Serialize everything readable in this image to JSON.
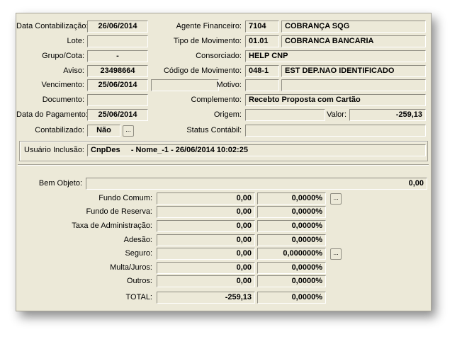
{
  "header": {
    "data_contabilizacao": {
      "label": "Data Contabilização:",
      "value": "26/06/2014"
    },
    "lote": {
      "label": "Lote:",
      "value": ""
    },
    "grupo_cota": {
      "label": "Grupo/Cota:",
      "value": "-"
    },
    "aviso": {
      "label": "Aviso:",
      "value": "23498664"
    },
    "vencimento": {
      "label": "Vencimento:",
      "value": "25/06/2014"
    },
    "documento": {
      "label": "Documento:",
      "value": ""
    },
    "data_pagamento": {
      "label": "Data do Pagamento:",
      "value": "25/06/2014"
    },
    "contabilizado": {
      "label": "Contabilizado:",
      "value": "Não",
      "button": "..."
    },
    "agente_financeiro": {
      "label": "Agente Financeiro:",
      "code": "7104",
      "name": "COBRANÇA SQG"
    },
    "tipo_movimento": {
      "label": "Tipo de Movimento:",
      "code": "01.01",
      "name": "COBRANCA BANCARIA"
    },
    "consorciado": {
      "label": "Consorciado:",
      "value": "HELP CNP"
    },
    "codigo_movimento": {
      "label": "Código de Movimento:",
      "code": "048-1",
      "name": "EST DEP.NAO IDENTIFICADO"
    },
    "motivo": {
      "label": "Motivo:",
      "code": "",
      "name": ""
    },
    "complemento": {
      "label": "Complemento:",
      "value": "Recebto Proposta com Cartão"
    },
    "origem": {
      "label": "Origem:",
      "value": ""
    },
    "valor": {
      "label": "Valor:",
      "value": "-259,13"
    },
    "status_contabil": {
      "label": "Status Contábil:",
      "value": ""
    },
    "usuario_inclusao": {
      "label": "Usuário Inclusão:",
      "value": "CnpDes     - Nome_-1 - 26/06/2014 10:02:25"
    }
  },
  "values": {
    "bem_objeto": {
      "label": "Bem Objeto:",
      "value": "0,00"
    },
    "rows": [
      {
        "label": "Fundo Comum:",
        "value": "0,00",
        "pct": "0,0000%",
        "button": "..."
      },
      {
        "label": "Fundo de Reserva:",
        "value": "0,00",
        "pct": "0,0000%"
      },
      {
        "label": "Taxa de Administração:",
        "value": "0,00",
        "pct": "0,0000%"
      },
      {
        "label": "Adesão:",
        "value": "0,00",
        "pct": "0,0000%"
      },
      {
        "label": "Seguro:",
        "value": "0,00",
        "pct": "0,000000%",
        "button": "..."
      },
      {
        "label": "Multa/Juros:",
        "value": "0,00",
        "pct": "0,0000%"
      },
      {
        "label": "Outros:",
        "value": "0,00",
        "pct": "0,0000%"
      },
      {
        "label": "TOTAL:",
        "value": "-259,13",
        "pct": "0,0000%"
      }
    ]
  }
}
